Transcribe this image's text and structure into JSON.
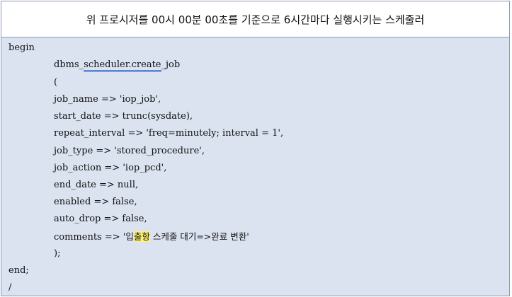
{
  "title": "위 프로시저를 00시 00분 00초를 기준으로 6시간마다 실행시키는 스케줄러",
  "code": {
    "begin": "begin",
    "create_prefix": "dbms_",
    "create_underlined": "scheduler.create",
    "create_suffix": "_job",
    "open_paren": "(",
    "job_name": "job_name => 'iop_job',",
    "start_date": "start_date => trunc(sysdate),",
    "repeat_interval": "repeat_interval => 'freq=minutely; interval = 1',",
    "job_type": "job_type => 'stored_procedure',",
    "job_action": "job_action => 'iop_pcd',",
    "end_date": "end_date => null,",
    "enabled": "enabled => false,",
    "auto_drop": "auto_drop => false,",
    "comments_prefix": "comments => '",
    "comments_ko_1": "입",
    "comments_ko_hl": "출항",
    "comments_ko_2": " 스케줄 대기=>완료 변환",
    "comments_suffix": "'",
    "close": ");",
    "end": "end;",
    "slash": "/"
  }
}
